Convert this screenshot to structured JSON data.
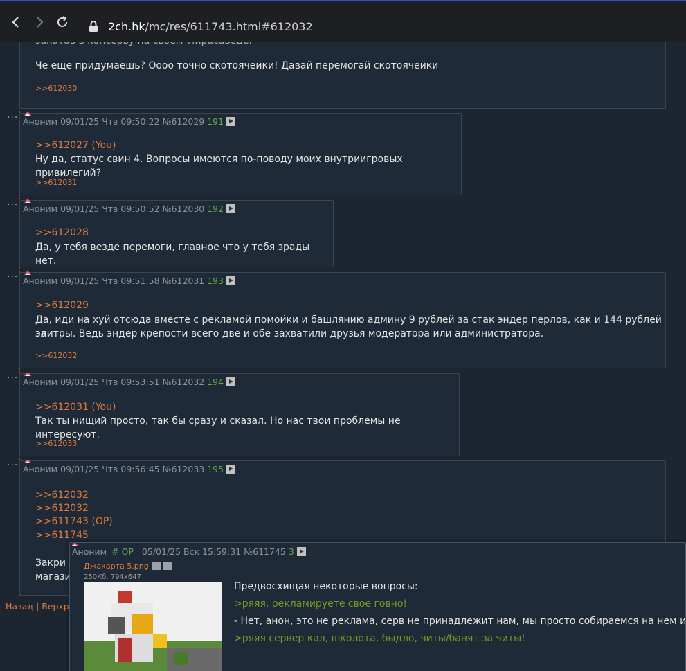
{
  "browser": {
    "url_host": "2ch.hk",
    "url_path": "/mc/res/611743.html#612032"
  },
  "top_post": {
    "partial_line": "закатав в консерву на своем т.ирасаведе.",
    "text": "Че еще придумаешь? Оооо точно скотоячейки! Давай перемогай скотоячейки",
    "backlink": ">>612030"
  },
  "posts": [
    {
      "name": "Аноним",
      "date": "09/01/25 Чтв 09:50:22",
      "id": "№612029",
      "count": "191",
      "replies": [
        ">>612027 (You)"
      ],
      "text": [
        "Ну да, статус свин 4. Вопросы имеются по-поводу моих внутриигровых привилегий?"
      ],
      "backlink": ">>612031"
    },
    {
      "name": "Аноним",
      "date": "09/01/25 Чтв 09:50:52",
      "id": "№612030",
      "count": "192",
      "replies": [
        ">>612028"
      ],
      "text": [
        "Да, у тебя везде перемоги, главное что у тебя зрады нет."
      ],
      "backlink": ""
    },
    {
      "name": "Аноним",
      "date": "09/01/25 Чтв 09:51:58",
      "id": "№612031",
      "count": "193",
      "replies": [
        ">>612029"
      ],
      "text": [
        "Да, иди на хуй отсюда вместе с рекламой помойки и башлянию админу 9 рублей за стак эндер перлов, как и 144 рублей за",
        "элитры. Ведь эндер крепости всего две и обе захватили друзья модератора или администратора."
      ],
      "backlink": ">>612032"
    },
    {
      "name": "Аноним",
      "date": "09/01/25 Чтв 09:53:51",
      "id": "№612032",
      "count": "194",
      "replies": [
        ">>612031 (You)"
      ],
      "text": [
        "Так ты нищий просто, так бы сразу и сказал. Но нас твои проблемы не интересуют."
      ],
      "backlink": ">>612033"
    },
    {
      "name": "Аноним",
      "date": "09/01/25 Чтв 09:56:45",
      "id": "№612033",
      "count": "195",
      "replies": [
        ">>612032",
        ">>612032",
        ">>611743 (OP)",
        ">>611745"
      ],
      "text": [
        "Закри",
        "магази"
      ],
      "backlink": ""
    }
  ],
  "footer": {
    "back": "Назад",
    "separator": "|",
    "up": "Верхр"
  },
  "popup": {
    "name": "Аноним",
    "op_tag": "# OP",
    "date": "05/01/25 Вск 15:59:31",
    "id": "№611745",
    "count": "3",
    "file_name": "Джакарта 5.png",
    "file_info": "250Кб, 794x647",
    "lines": [
      {
        "text": "Предвосхищая некоторые вопросы:",
        "style": "normal"
      },
      {
        "text": ">ряяя, рекламируете свое говно!",
        "style": "green"
      },
      {
        "text": "- Нет, анон, это не реклама, серв не принадлежит нам, мы просто собираемся на нем играть",
        "style": "normal"
      },
      {
        "text": ">ряяя сервер кал, школота, быдло, читы/банят за читы!",
        "style": "green"
      }
    ]
  },
  "colors": {
    "link": "#e07a3a",
    "greentext": "#789922",
    "count": "#6aa84f",
    "post_bg": "#1e2a37",
    "page_bg": "#1c2530"
  }
}
